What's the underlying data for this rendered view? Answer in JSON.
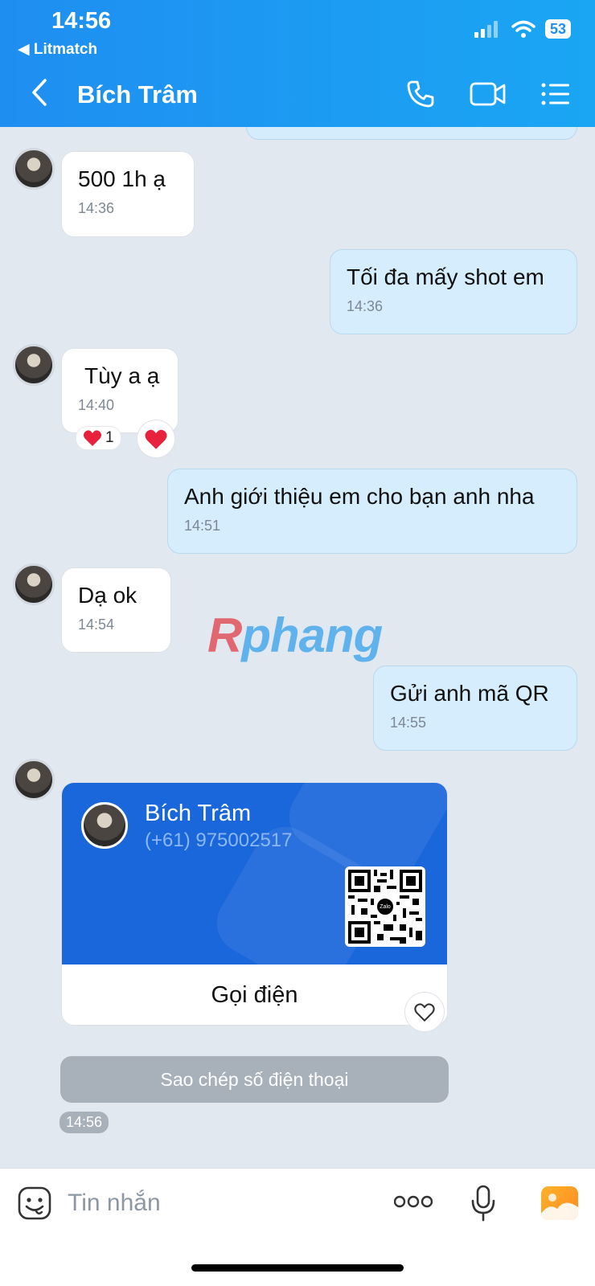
{
  "status_bar": {
    "time": "14:56",
    "back_app": "◀ Litmatch",
    "battery": "53"
  },
  "header": {
    "title": "Bích Trâm",
    "icons": [
      "back-chevron-icon",
      "phone-icon",
      "video-call-icon",
      "menu-list-icon"
    ]
  },
  "messages": [
    {
      "side": "in",
      "text": "500 1h ạ",
      "time": "14:36"
    },
    {
      "side": "out",
      "text": "Tối đa mấy shot em",
      "time": "14:36"
    },
    {
      "side": "in",
      "text": "Tùy a ạ",
      "time": "14:40",
      "reaction_count": "1"
    },
    {
      "side": "out",
      "text": "Anh giới thiệu em cho bạn anh nha",
      "time": "14:51"
    },
    {
      "side": "in",
      "text": "Dạ ok",
      "time": "14:54"
    },
    {
      "side": "out",
      "text": "Gửi anh mã QR",
      "time": "14:55"
    }
  ],
  "watermark": {
    "part1": "R",
    "part2": "phang"
  },
  "contact_card": {
    "name": "Bích Trâm",
    "phone": "(+61) 975002517",
    "qr_badge": "Zalo",
    "call_label": "Gọi điện",
    "copy_label": "Sao chép số điện thoại",
    "time": "14:56"
  },
  "composer": {
    "placeholder": "Tin nhắn"
  },
  "colors": {
    "header_blue": "#1f8ef1",
    "outgoing_bubble": "#d5edfc",
    "card_blue": "#1a67dc",
    "background": "#e2e8f0"
  }
}
